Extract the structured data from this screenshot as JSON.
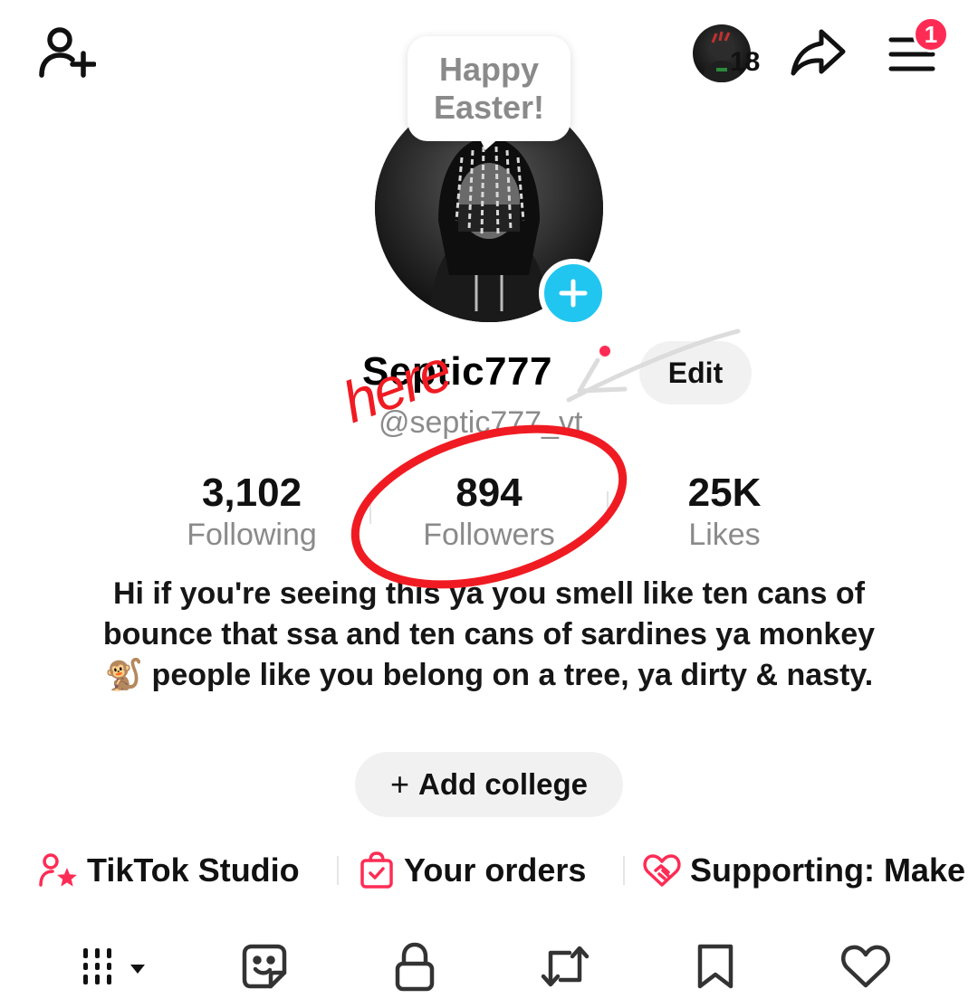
{
  "header": {
    "story_count": "18",
    "menu_badge": "1"
  },
  "profile": {
    "bubble_text": "Happy Easter!",
    "display_name": "Septic777",
    "edit_label": "Edit",
    "username": "@septic777_vt"
  },
  "stats": [
    {
      "value": "3,102",
      "label": "Following"
    },
    {
      "value": "894",
      "label": "Followers"
    },
    {
      "value": "25K",
      "label": "Likes"
    }
  ],
  "bio": "Hi if you're seeing this ya you smell like ten cans of bounce that ssa and ten cans of sardines ya monkey 🐒 people like you belong on a tree, ya dirty & nasty.",
  "add_college": {
    "icon": "+",
    "label": "Add college"
  },
  "shortcuts": [
    {
      "icon": "person-star-icon",
      "label": "TikTok Studio"
    },
    {
      "icon": "shopping-bag-icon",
      "label": "Your orders"
    },
    {
      "icon": "heart-handshake-icon",
      "label": "Supporting: Make"
    }
  ],
  "tabs": [
    {
      "icon": "grid-icon",
      "name": "videos"
    },
    {
      "icon": "sticker-icon",
      "name": "stickers"
    },
    {
      "icon": "lock-icon",
      "name": "private"
    },
    {
      "icon": "repost-icon",
      "name": "reposts"
    },
    {
      "icon": "bookmark-icon",
      "name": "favorites"
    },
    {
      "icon": "heart-icon",
      "name": "liked"
    }
  ],
  "annotation": {
    "text": "here",
    "color": "#f01b22"
  },
  "colors": {
    "accent": "#fe2c55",
    "add_photo": "#20c6f0",
    "annotation": "#f01b22"
  }
}
